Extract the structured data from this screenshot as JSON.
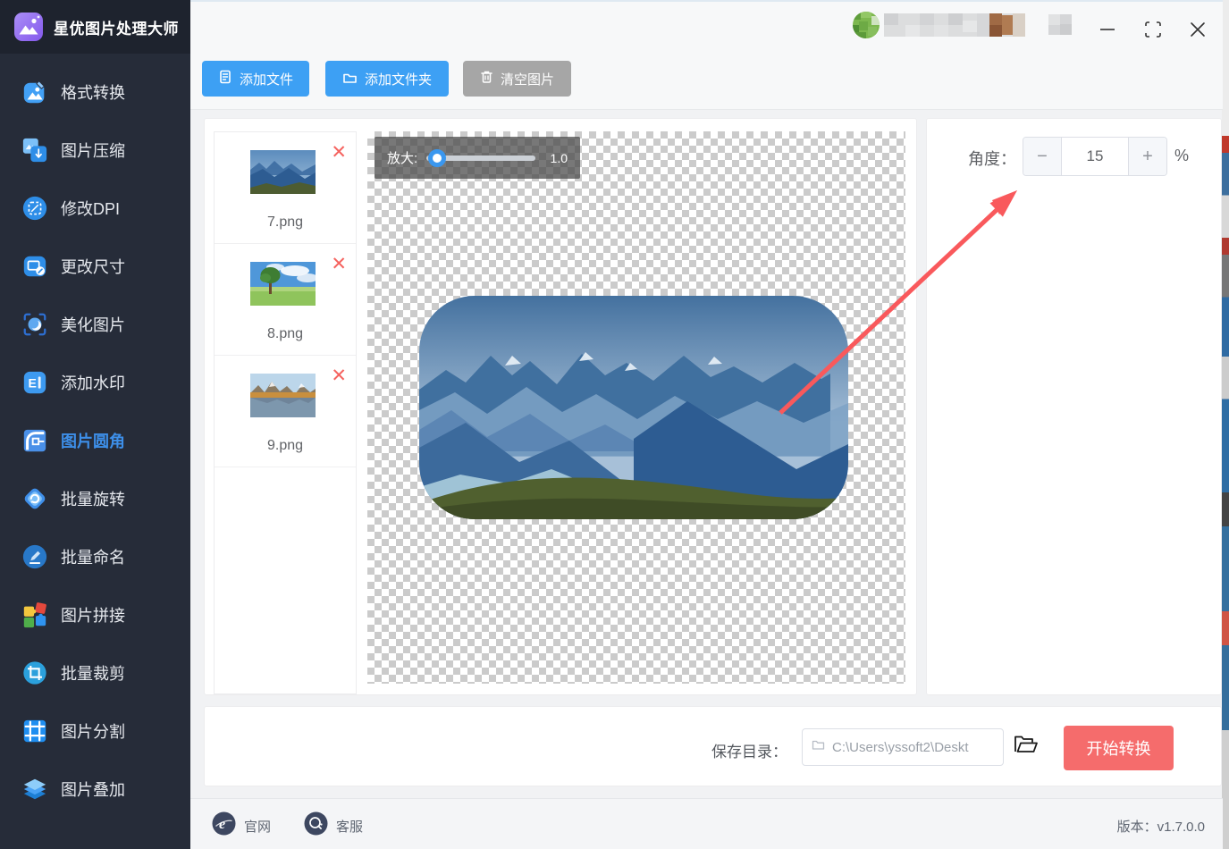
{
  "app": {
    "title": "星优图片处理大师"
  },
  "sidebar": {
    "items": [
      {
        "label": "格式转换"
      },
      {
        "label": "图片压缩"
      },
      {
        "label": "修改DPI"
      },
      {
        "label": "更改尺寸"
      },
      {
        "label": "美化图片"
      },
      {
        "label": "添加水印"
      },
      {
        "label": "图片圆角",
        "active": true
      },
      {
        "label": "批量旋转"
      },
      {
        "label": "批量命名"
      },
      {
        "label": "图片拼接"
      },
      {
        "label": "批量裁剪"
      },
      {
        "label": "图片分割"
      },
      {
        "label": "图片叠加"
      }
    ]
  },
  "toolbar": {
    "buttons": [
      {
        "label": "添加文件"
      },
      {
        "label": "添加文件夹"
      },
      {
        "label": "清空图片"
      }
    ]
  },
  "files": [
    {
      "name": "7.png"
    },
    {
      "name": "8.png"
    },
    {
      "name": "9.png"
    }
  ],
  "preview": {
    "zoom_label": "放大:",
    "zoom_value": "1.0"
  },
  "controls": {
    "angle_label": "角度：",
    "angle_value": "15",
    "minus": "−",
    "plus": "+",
    "unit": "%"
  },
  "save": {
    "label": "保存目录：",
    "path": "C:\\Users\\yssoft2\\Deskt",
    "start": "开始转换"
  },
  "footer": {
    "website": "官网",
    "support": "客服",
    "version": "版本：v1.7.0.0"
  },
  "icons": {
    "delete": "✕"
  },
  "colors": {
    "accent_blue": "#3da0f4",
    "active_blue": "#3d8fe9",
    "danger_red": "#f56c6c",
    "sidebar_bg": "#262c39"
  }
}
